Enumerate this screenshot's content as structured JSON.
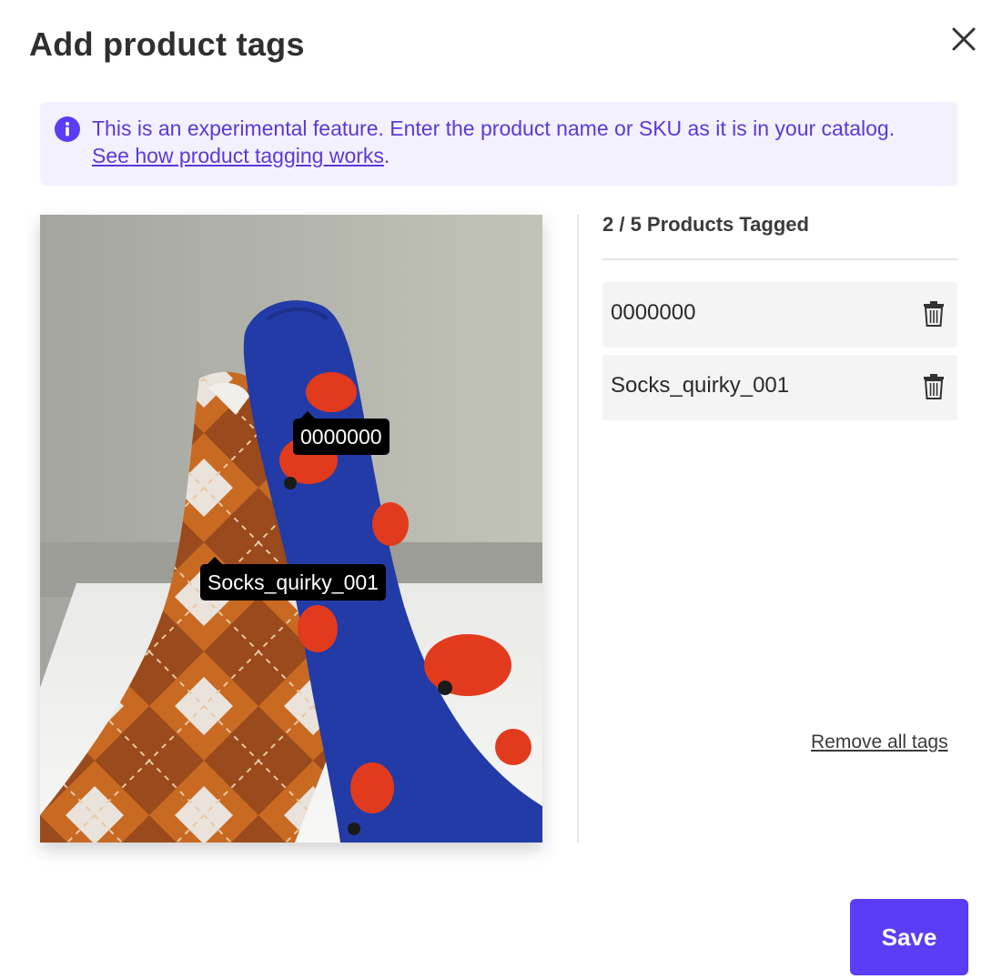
{
  "dialog": {
    "title": "Add product tags"
  },
  "banner": {
    "text": "This is an experimental feature. Enter the product name or SKU as it is in your catalog. ",
    "link_text": "See how product tagging works",
    "suffix": ".",
    "icon": "info-icon"
  },
  "image": {
    "tags": [
      {
        "label": "0000000"
      },
      {
        "label": "Socks_quirky_001"
      }
    ]
  },
  "sidebar": {
    "count_text": "2 / 5 Products Tagged",
    "tags": [
      {
        "label": "0000000",
        "icon": "trash-icon"
      },
      {
        "label": "Socks_quirky_001",
        "icon": "trash-icon"
      }
    ],
    "remove_all": "Remove all tags"
  },
  "footer": {
    "save_label": "Save"
  },
  "colors": {
    "accent": "#5b3df5",
    "banner_bg": "#f3f1fd",
    "banner_text": "#5a3ad6"
  }
}
